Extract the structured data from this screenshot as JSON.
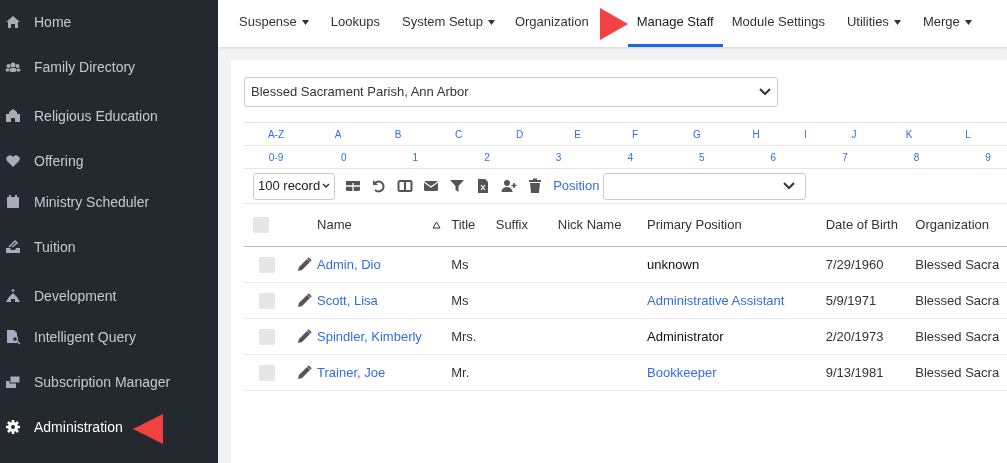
{
  "sidebar": {
    "items": [
      {
        "label": "Home",
        "selected": false
      },
      {
        "label": "Family Directory",
        "selected": false
      },
      {
        "label": "Religious Education",
        "selected": false
      },
      {
        "label": "Offering",
        "selected": false
      },
      {
        "label": "Ministry Scheduler",
        "selected": false
      },
      {
        "label": "Tuition",
        "selected": false
      },
      {
        "label": "Development",
        "selected": false
      },
      {
        "label": "Intelligent Query",
        "selected": false
      },
      {
        "label": "Subscription Manager",
        "selected": false
      },
      {
        "label": "Administration",
        "selected": true
      }
    ]
  },
  "top_nav": {
    "tabs": [
      {
        "label": "Suspense",
        "dropdown": true,
        "selected": false
      },
      {
        "label": "Lookups",
        "dropdown": false,
        "selected": false
      },
      {
        "label": "System Setup",
        "dropdown": true,
        "selected": false
      },
      {
        "label": "Organization",
        "dropdown": false,
        "selected": false
      },
      {
        "label": "Manage Staff",
        "dropdown": false,
        "selected": true
      },
      {
        "label": "Module Settings",
        "dropdown": false,
        "selected": false
      },
      {
        "label": "Utilities",
        "dropdown": true,
        "selected": false
      },
      {
        "label": "Merge",
        "dropdown": true,
        "selected": false
      }
    ]
  },
  "parish_select": {
    "value": "Blessed Sacrament Parish, Ann Arbor"
  },
  "letter_filter": [
    "A-Z",
    "A",
    "B",
    "C",
    "D",
    "E",
    "F",
    "G",
    "H",
    "I",
    "J",
    "K",
    "L"
  ],
  "number_filter": [
    "0-9",
    "0",
    "1",
    "2",
    "3",
    "4",
    "5",
    "6",
    "7",
    "8",
    "9"
  ],
  "toolbar": {
    "page_size": "100 record",
    "position_label": "Position"
  },
  "table": {
    "select_all_checked": false,
    "columns": [
      "Name",
      "Title",
      "Suffix",
      "Nick Name",
      "Primary Position",
      "Date of Birth",
      "Organization"
    ],
    "rows": [
      {
        "checked": false,
        "name": "Admin, Dio",
        "title": "Ms",
        "primary_position": "unknown",
        "position_linked": false,
        "date_of_birth": "7/29/1960",
        "organization": "Blessed Sacra"
      },
      {
        "checked": false,
        "name": "Scott, Lisa",
        "title": "Ms",
        "primary_position": "Administrative Assistant",
        "position_linked": true,
        "date_of_birth": "5/9/1971",
        "organization": "Blessed Sacra"
      },
      {
        "checked": false,
        "name": "Spindler, Kimberly",
        "title": "Mrs.",
        "primary_position": "Administrator",
        "position_linked": false,
        "date_of_birth": "2/20/1973",
        "organization": "Blessed Sacra"
      },
      {
        "checked": false,
        "name": "Trainer, Joe",
        "title": "Mr.",
        "primary_position": "Bookkeeper",
        "position_linked": true,
        "date_of_birth": "9/13/1981",
        "organization": "Blessed Sacra"
      }
    ]
  }
}
